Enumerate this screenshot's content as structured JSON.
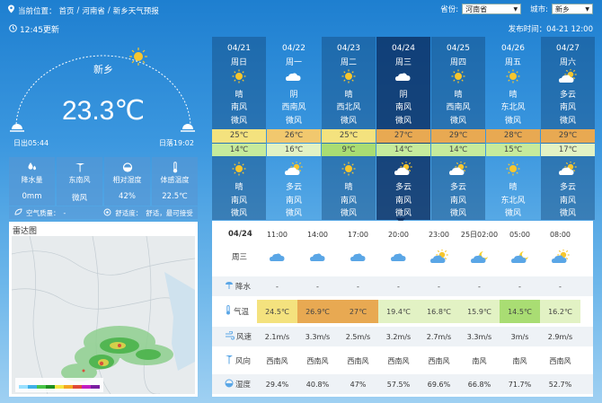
{
  "breadcrumb": {
    "prefix": "当前位置：",
    "items": [
      "首页",
      "河南省",
      "新乡天气预报"
    ],
    "sep": "/"
  },
  "selectors": {
    "province_label": "省份:",
    "province_value": "河南省",
    "city_label": "城市:",
    "city_value": "新乡"
  },
  "update_time": "12:45更新",
  "publish_time": "发布时间：04-21 12:00",
  "current": {
    "city": "新乡",
    "temperature": "23.3℃",
    "sunrise": "日出05:44",
    "sunset": "日落19:02"
  },
  "stats": [
    {
      "icon": "raindrop-icon",
      "label": "降水量",
      "value": "0mm"
    },
    {
      "icon": "wind-turbine-icon",
      "label": "东南风",
      "value": "微风"
    },
    {
      "icon": "humidity-icon",
      "label": "相对湿度",
      "value": "42%"
    },
    {
      "icon": "thermometer-icon",
      "label": "体感温度",
      "value": "22.5℃"
    }
  ],
  "aqi": {
    "label": "空气质量：",
    "value": "-",
    "comfort_label": "舒适度：",
    "comfort_value": "舒适，最可接受"
  },
  "radar_title": "雷达图",
  "colors": {
    "hi_hot": "#e8a952",
    "hi_warm": "#f1c86e",
    "hi_mild": "#f4e27e",
    "lo_green": "#a9dd73",
    "lo_light": "#c6eb9c",
    "lo_pale": "#e2f2c4"
  },
  "daily": [
    {
      "date": "04/21",
      "week": "周日",
      "day_icon": "sunny-icon",
      "day_weather": "晴",
      "day_wind": "南风",
      "day_level": "微风",
      "high": "25℃",
      "high_color": "#f4e27e",
      "low": "14℃",
      "low_color": "#c6eb9c",
      "night_icon": "sunny-icon",
      "night_weather": "晴",
      "night_wind": "南风",
      "night_level": "微风"
    },
    {
      "date": "04/22",
      "week": "周一",
      "day_icon": "cloudy-icon",
      "day_weather": "阴",
      "day_wind": "西南风",
      "day_level": "微风",
      "high": "26℃",
      "high_color": "#f1c86e",
      "low": "16℃",
      "low_color": "#e2f2c4",
      "night_icon": "partly-cloudy-icon",
      "night_weather": "多云",
      "night_wind": "南风",
      "night_level": "微风"
    },
    {
      "date": "04/23",
      "week": "周二",
      "day_icon": "sunny-icon",
      "day_weather": "晴",
      "day_wind": "西北风",
      "day_level": "微风",
      "high": "25℃",
      "high_color": "#f4e27e",
      "low": "9℃",
      "low_color": "#a9dd73",
      "night_icon": "sunny-icon",
      "night_weather": "晴",
      "night_wind": "南风",
      "night_level": "微风"
    },
    {
      "date": "04/24",
      "week": "周三",
      "day_icon": "cloudy-icon",
      "day_weather": "阴",
      "day_wind": "南风",
      "day_level": "微风",
      "high": "27℃",
      "high_color": "#e8a952",
      "low": "14℃",
      "low_color": "#c6eb9c",
      "night_icon": "partly-cloudy-icon",
      "night_weather": "多云",
      "night_wind": "南风",
      "night_level": "微风"
    },
    {
      "date": "04/25",
      "week": "周四",
      "day_icon": "sunny-icon",
      "day_weather": "晴",
      "day_wind": "西南风",
      "day_level": "微风",
      "high": "29℃",
      "high_color": "#e8a952",
      "low": "14℃",
      "low_color": "#c6eb9c",
      "night_icon": "partly-cloudy-icon",
      "night_weather": "多云",
      "night_wind": "南风",
      "night_level": "微风"
    },
    {
      "date": "04/26",
      "week": "周五",
      "day_icon": "sunny-icon",
      "day_weather": "晴",
      "day_wind": "东北风",
      "day_level": "微风",
      "high": "28℃",
      "high_color": "#e8a952",
      "low": "15℃",
      "low_color": "#c6eb9c",
      "night_icon": "sunny-icon",
      "night_weather": "晴",
      "night_wind": "东北风",
      "night_level": "微风"
    },
    {
      "date": "04/27",
      "week": "周六",
      "day_icon": "partly-cloudy-icon",
      "day_weather": "多云",
      "day_wind": "南风",
      "day_level": "微风",
      "high": "29℃",
      "high_color": "#e8a952",
      "low": "17℃",
      "low_color": "#e2f2c4",
      "night_icon": "partly-cloudy-icon",
      "night_weather": "多云",
      "night_wind": "南风",
      "night_level": "微风"
    }
  ],
  "hourly": {
    "date": "04/24",
    "week": "周三",
    "times": [
      "11:00",
      "14:00",
      "17:00",
      "20:00",
      "23:00",
      "25日02:00",
      "05:00",
      "08:00"
    ],
    "icons": [
      "cloudy-icon",
      "cloudy-icon",
      "cloudy-icon",
      "cloudy-icon",
      "partly-cloudy-icon",
      "partly-cloudy-night-icon",
      "partly-cloudy-night-icon",
      "partly-cloudy-icon"
    ],
    "labels": {
      "precip": "降水",
      "temp": "气温",
      "wind_speed": "风速",
      "wind_dir": "风向",
      "humidity": "湿度"
    },
    "precip": [
      "-",
      "-",
      "-",
      "-",
      "-",
      "-",
      "-",
      "-"
    ],
    "temps": [
      "24.5℃",
      "26.9℃",
      "27℃",
      "19.4℃",
      "16.8℃",
      "15.9℃",
      "14.5℃",
      "16.2℃"
    ],
    "temp_colors": [
      "#f4e27e",
      "#e8a952",
      "#e8a952",
      "#e2f2c4",
      "#e2f2c4",
      "#e2f2c4",
      "#a9dd73",
      "#e2f2c4"
    ],
    "wind_speed": [
      "2.1m/s",
      "3.3m/s",
      "2.5m/s",
      "3.2m/s",
      "2.7m/s",
      "3.3m/s",
      "3m/s",
      "2.9m/s"
    ],
    "wind_dir": [
      "西南风",
      "西南风",
      "西南风",
      "西南风",
      "西南风",
      "南风",
      "南风",
      "西南风"
    ],
    "humidity": [
      "29.4%",
      "40.8%",
      "47%",
      "57.5%",
      "69.6%",
      "66.8%",
      "71.7%",
      "52.7%"
    ]
  }
}
